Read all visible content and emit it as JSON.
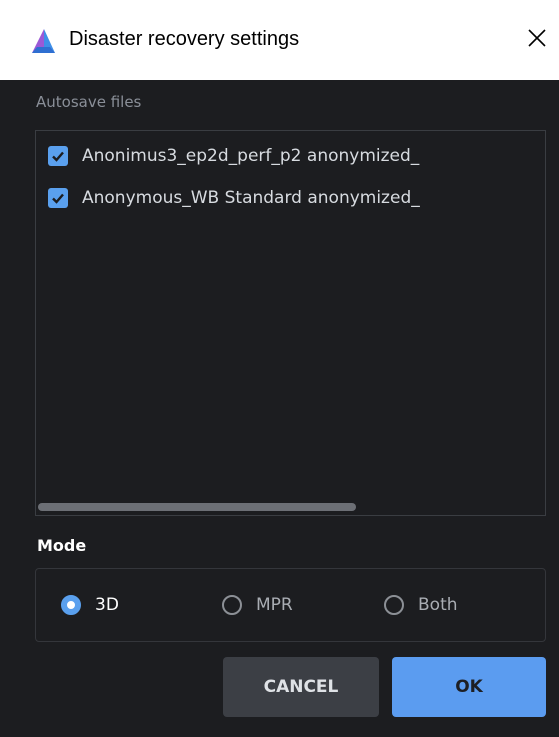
{
  "window": {
    "title": "Disaster recovery settings",
    "logo_icon": "app-logo-icon",
    "close_icon": "close-icon"
  },
  "autosave": {
    "label": "Autosave files",
    "files": [
      {
        "name": "Anonimus3_ep2d_perf_p2 anonymized_",
        "checked": true
      },
      {
        "name": "Anonymous_WB Standard anonymized_",
        "checked": true
      }
    ],
    "horizontal_scroll_fraction": 0.63
  },
  "mode": {
    "label": "Mode",
    "options": [
      {
        "label": "3D",
        "selected": true
      },
      {
        "label": "MPR",
        "selected": false
      },
      {
        "label": "Both",
        "selected": false
      }
    ]
  },
  "buttons": {
    "cancel_label": "CANCEL",
    "ok_label": "OK"
  },
  "colors": {
    "accent": "#5aa0ee",
    "background": "#1c1d20",
    "titlebar": "#ffffff"
  }
}
